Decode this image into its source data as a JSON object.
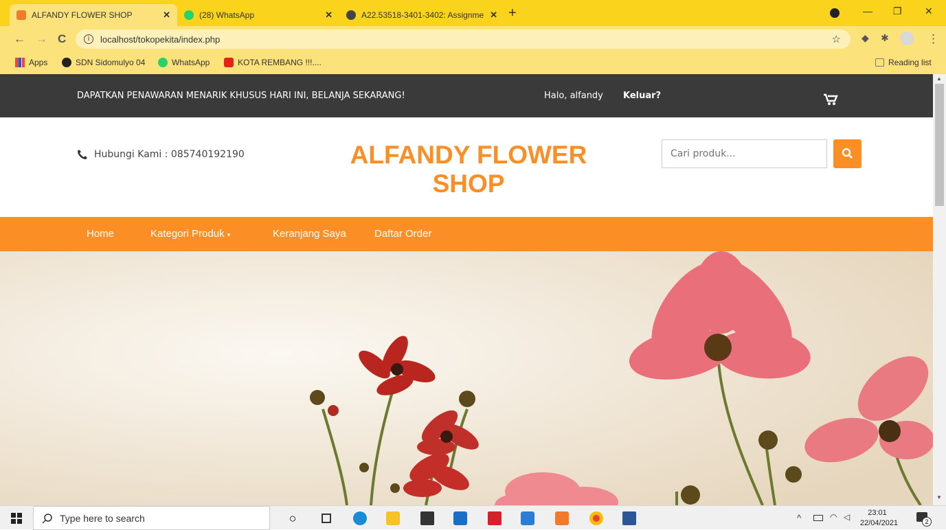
{
  "browser": {
    "tabs": [
      {
        "label": "ALFANDY FLOWER SHOP",
        "active": true
      },
      {
        "label": "(28) WhatsApp",
        "active": false
      },
      {
        "label": "A22.53518-3401-3402: Assignme",
        "active": false
      }
    ],
    "url": "localhost/tokopekita/index.php",
    "bookmarks": [
      "Apps",
      "SDN Sidomulyo 04",
      "WhatsApp",
      "KOTA REMBANG !!!...."
    ],
    "reading_list": "Reading list",
    "whatsapp_count": "28"
  },
  "site": {
    "promo": "DAPATKAN PENAWARAN MENARIK KHUSUS HARI INI, BELANJA SEKARANG!",
    "greeting": "Halo, alfandy",
    "logout": "Keluar?",
    "contact": "Hubungi Kami : 085740192190",
    "brand_line1": "ALFANDY FLOWER",
    "brand_line2": "SHOP",
    "search_placeholder": "Cari produk...",
    "nav": {
      "home": "Home",
      "categories": "Kategori Produk",
      "cart": "Keranjang Saya",
      "orders": "Daftar Order"
    },
    "colors": {
      "accent": "#fb8f26",
      "topbar": "#3a3a3a"
    }
  },
  "taskbar": {
    "search_placeholder": "Type here to search",
    "time": "23:01",
    "date": "22/04/2021",
    "notification_count": "2"
  }
}
